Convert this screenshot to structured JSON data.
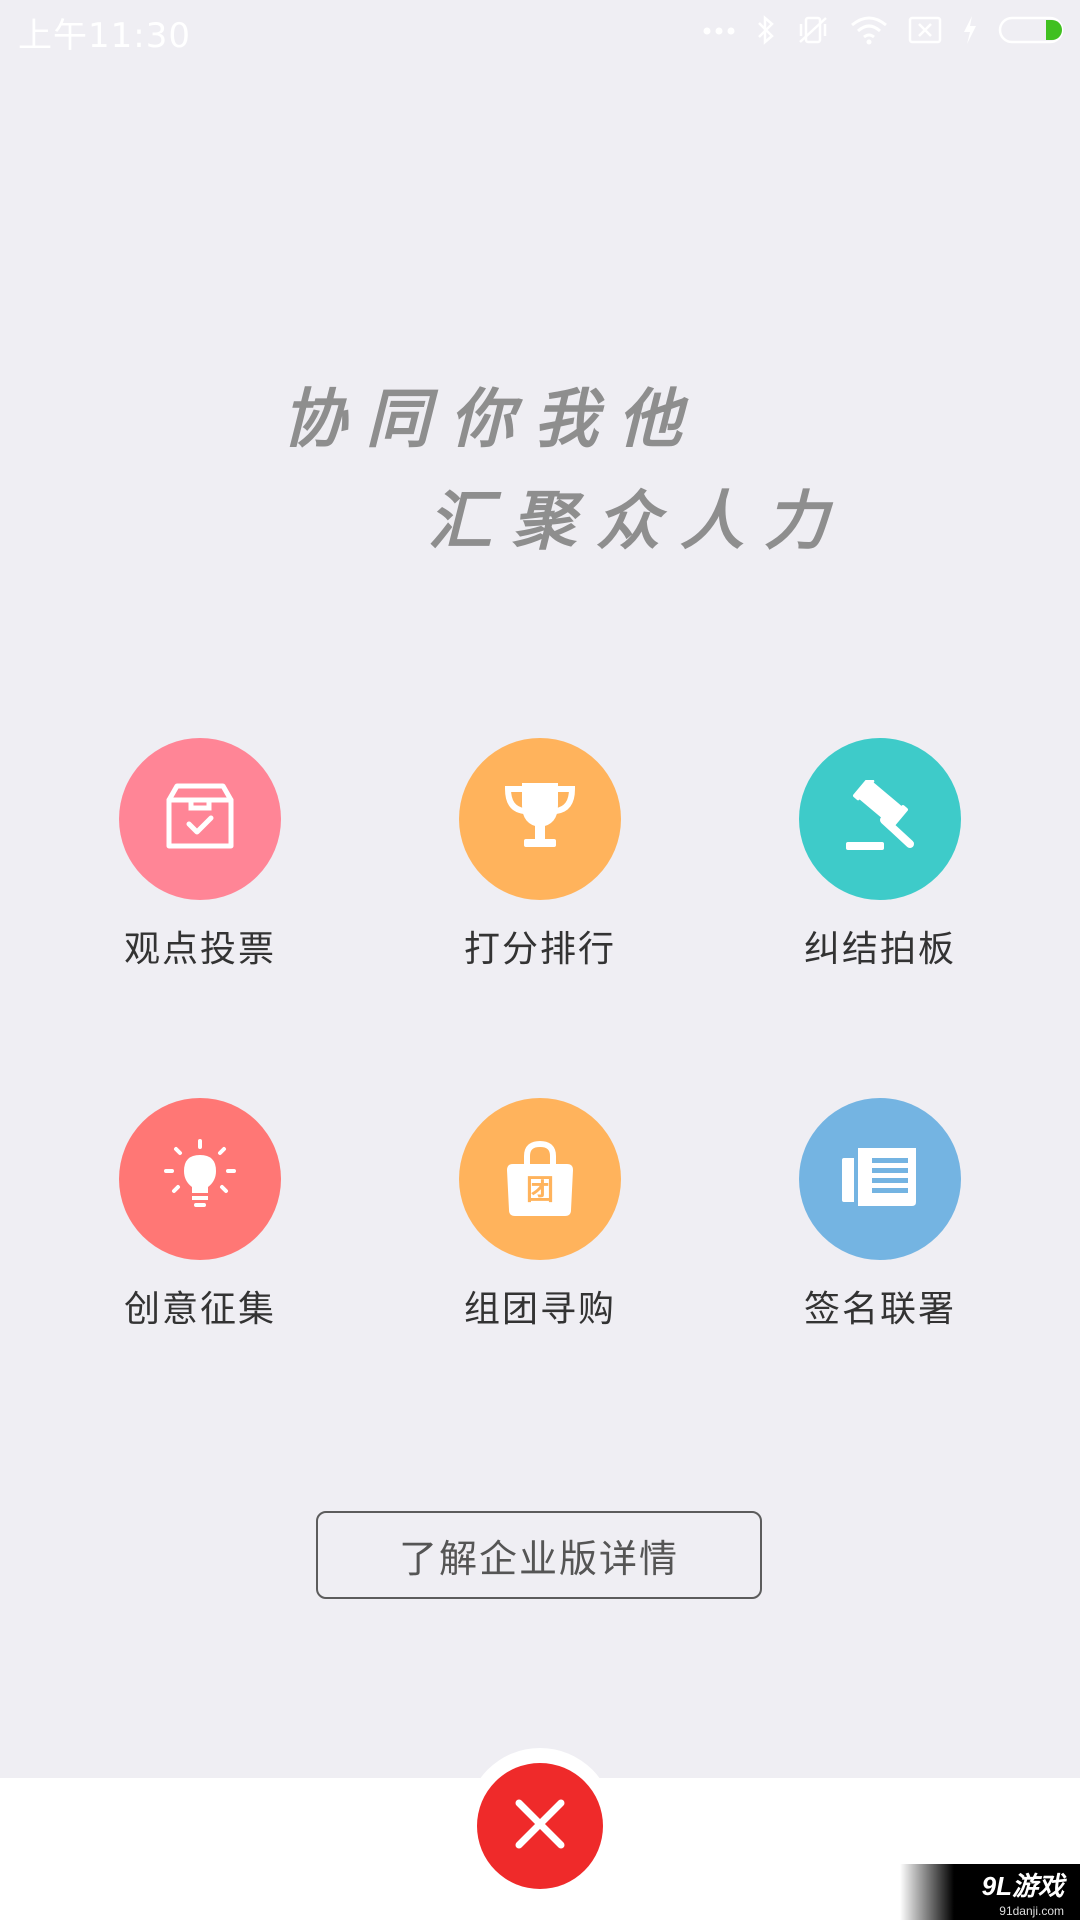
{
  "status_bar": {
    "time": "上午11:30",
    "icons": [
      "signal-dots-icon",
      "bluetooth-icon",
      "vibrate-off-icon",
      "wifi-icon",
      "no-sim-icon",
      "charging-bolt-icon",
      "battery-icon"
    ]
  },
  "slogan": {
    "line1": "协同你我他",
    "line2": "汇聚众人力"
  },
  "features": [
    {
      "label": "观点投票",
      "icon": "ballot-box-icon",
      "color": "#ff8596"
    },
    {
      "label": "打分排行",
      "icon": "trophy-icon",
      "color": "#ffb35c"
    },
    {
      "label": "纠结拍板",
      "icon": "gavel-icon",
      "color": "#3ecbc9"
    },
    {
      "label": "创意征集",
      "icon": "lightbulb-icon",
      "color": "#ff7775"
    },
    {
      "label": "组团寻购",
      "icon": "shopping-bag-icon",
      "color": "#ffb35c",
      "icon_text": "团"
    },
    {
      "label": "签名联署",
      "icon": "document-icon",
      "color": "#74b4e2"
    }
  ],
  "enterprise_button": {
    "label": "了解企业版详情"
  },
  "close_button": {
    "icon": "close-icon",
    "color": "#ef2a2a"
  },
  "watermark": {
    "main": "9L游戏",
    "sub": "91danji.com"
  }
}
